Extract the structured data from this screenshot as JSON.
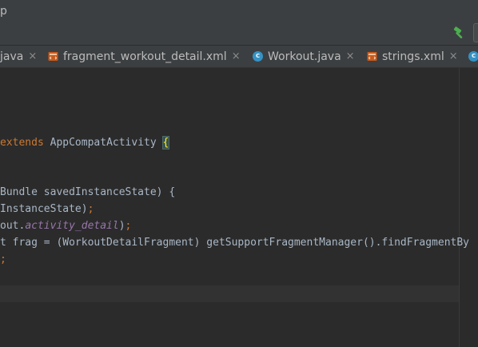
{
  "window": {
    "title_fragment": "p"
  },
  "toolbar": {
    "build_icon": "hammer-icon"
  },
  "tabs": [
    {
      "label": "java",
      "file_type": "java-partial",
      "close": "×"
    },
    {
      "label": "fragment_workout_detail.xml",
      "file_type": "xml",
      "close": "×"
    },
    {
      "label": "Workout.java",
      "file_type": "class",
      "icon_letter": "c",
      "close": "×"
    },
    {
      "label": "strings.xml",
      "file_type": "xml",
      "close": "×"
    },
    {
      "label": "",
      "file_type": "class",
      "icon_letter": "c",
      "close": ""
    }
  ],
  "code": {
    "line1": {
      "kw": "extends",
      "text": " AppCompatActivity ",
      "brace": "{"
    },
    "line2": {
      "text": "Bundle savedInstanceState) {"
    },
    "line3": {
      "text": "InstanceState)",
      "semi": ";"
    },
    "line4": {
      "pre": "out.",
      "field": "activity_detail",
      "post": ")",
      "semi": ";"
    },
    "line5": {
      "text": "t frag = (WorkoutDetailFragment) getSupportFragmentManager().findFragmentBy"
    },
    "line6": {
      "semi": ";"
    }
  },
  "colors": {
    "background": "#2b2b2b",
    "keyword": "#cc7832",
    "field": "#9876aa",
    "default_text": "#a9b7c6",
    "build_icon": "#4caf50"
  }
}
